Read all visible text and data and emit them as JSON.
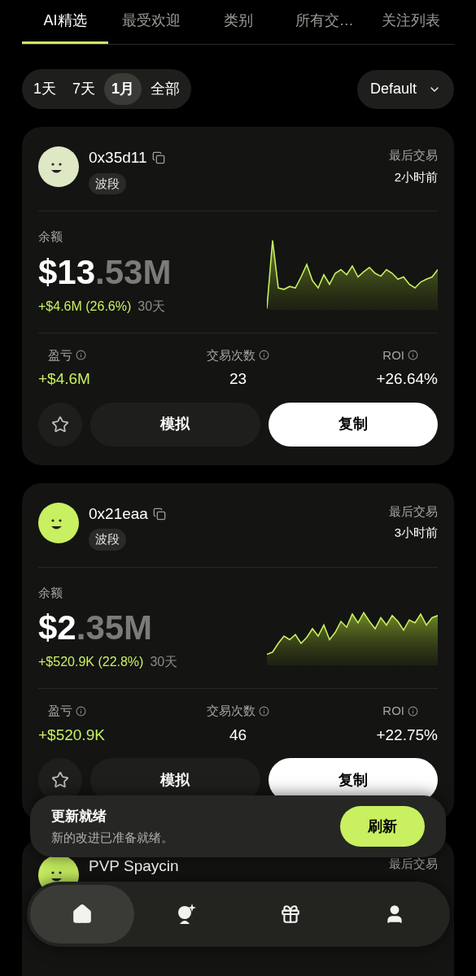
{
  "tabs": [
    {
      "label": "AI精选",
      "selected": true
    },
    {
      "label": "最受欢迎",
      "selected": false
    },
    {
      "label": "类别",
      "selected": false
    },
    {
      "label": "所有交…",
      "selected": false
    },
    {
      "label": "关注列表",
      "selected": false
    }
  ],
  "periods": [
    {
      "label": "1天",
      "selected": false
    },
    {
      "label": "7天",
      "selected": false
    },
    {
      "label": "1月",
      "selected": true
    },
    {
      "label": "全部",
      "selected": false
    }
  ],
  "sort": {
    "value": "Default"
  },
  "cards": [
    {
      "color": "#dfe8c4",
      "name": "0x35d11",
      "tag": "波段",
      "last_trade_label": "最后交易",
      "last_trade": "2小时前",
      "balance_label": "余额",
      "balance_main": "$13",
      "balance_fraction": ".53M",
      "change": "+$4.6M (26.6%)",
      "period": "30天",
      "stats": [
        {
          "label": "盈亏",
          "value": "+$4.6M",
          "kind": "gain"
        },
        {
          "label": "交易次数",
          "value": "23",
          "kind": "plain"
        },
        {
          "label": "ROI",
          "value": "+26.64%",
          "kind": "plain"
        }
      ],
      "starred": false,
      "simulate": "模拟",
      "copy": "复制"
    },
    {
      "color": "#c8f060",
      "name": "0x21eaa",
      "tag": "波段",
      "last_trade_label": "最后交易",
      "last_trade": "3小时前",
      "balance_label": "余额",
      "balance_main": "$2",
      "balance_fraction": ".35M",
      "change": "+$520.9K (22.8%)",
      "period": "30天",
      "stats": [
        {
          "label": "盈亏",
          "value": "+$520.9K",
          "kind": "gain"
        },
        {
          "label": "交易次数",
          "value": "46",
          "kind": "plain"
        },
        {
          "label": "ROI",
          "value": "+22.75%",
          "kind": "plain"
        }
      ],
      "starred": false,
      "simulate": "模拟",
      "copy": "复制"
    }
  ],
  "next_card": {
    "color": "#c8f060",
    "name": "PVP Spaycin",
    "last_trade_label": "最后交易"
  },
  "toast": {
    "title": "更新就绪",
    "message": "新的改进已准备就绪。",
    "action": "刷新"
  },
  "nav": [
    {
      "kind": "home",
      "selected": true
    },
    {
      "kind": "crystal",
      "selected": false
    },
    {
      "kind": "gift",
      "selected": false
    },
    {
      "kind": "profile",
      "selected": false
    }
  ]
}
